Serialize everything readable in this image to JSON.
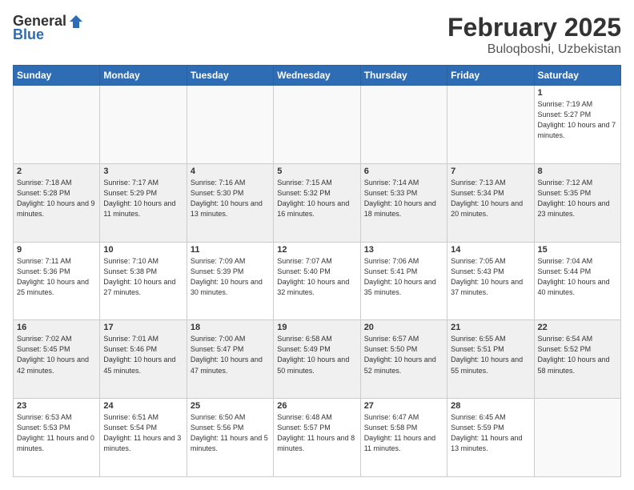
{
  "header": {
    "logo_general": "General",
    "logo_blue": "Blue",
    "title": "February 2025",
    "subtitle": "Buloqboshi, Uzbekistan"
  },
  "days_of_week": [
    "Sunday",
    "Monday",
    "Tuesday",
    "Wednesday",
    "Thursday",
    "Friday",
    "Saturday"
  ],
  "weeks": [
    {
      "shade": false,
      "days": [
        {
          "num": "",
          "info": ""
        },
        {
          "num": "",
          "info": ""
        },
        {
          "num": "",
          "info": ""
        },
        {
          "num": "",
          "info": ""
        },
        {
          "num": "",
          "info": ""
        },
        {
          "num": "",
          "info": ""
        },
        {
          "num": "1",
          "info": "Sunrise: 7:19 AM\nSunset: 5:27 PM\nDaylight: 10 hours and 7 minutes."
        }
      ]
    },
    {
      "shade": true,
      "days": [
        {
          "num": "2",
          "info": "Sunrise: 7:18 AM\nSunset: 5:28 PM\nDaylight: 10 hours and 9 minutes."
        },
        {
          "num": "3",
          "info": "Sunrise: 7:17 AM\nSunset: 5:29 PM\nDaylight: 10 hours and 11 minutes."
        },
        {
          "num": "4",
          "info": "Sunrise: 7:16 AM\nSunset: 5:30 PM\nDaylight: 10 hours and 13 minutes."
        },
        {
          "num": "5",
          "info": "Sunrise: 7:15 AM\nSunset: 5:32 PM\nDaylight: 10 hours and 16 minutes."
        },
        {
          "num": "6",
          "info": "Sunrise: 7:14 AM\nSunset: 5:33 PM\nDaylight: 10 hours and 18 minutes."
        },
        {
          "num": "7",
          "info": "Sunrise: 7:13 AM\nSunset: 5:34 PM\nDaylight: 10 hours and 20 minutes."
        },
        {
          "num": "8",
          "info": "Sunrise: 7:12 AM\nSunset: 5:35 PM\nDaylight: 10 hours and 23 minutes."
        }
      ]
    },
    {
      "shade": false,
      "days": [
        {
          "num": "9",
          "info": "Sunrise: 7:11 AM\nSunset: 5:36 PM\nDaylight: 10 hours and 25 minutes."
        },
        {
          "num": "10",
          "info": "Sunrise: 7:10 AM\nSunset: 5:38 PM\nDaylight: 10 hours and 27 minutes."
        },
        {
          "num": "11",
          "info": "Sunrise: 7:09 AM\nSunset: 5:39 PM\nDaylight: 10 hours and 30 minutes."
        },
        {
          "num": "12",
          "info": "Sunrise: 7:07 AM\nSunset: 5:40 PM\nDaylight: 10 hours and 32 minutes."
        },
        {
          "num": "13",
          "info": "Sunrise: 7:06 AM\nSunset: 5:41 PM\nDaylight: 10 hours and 35 minutes."
        },
        {
          "num": "14",
          "info": "Sunrise: 7:05 AM\nSunset: 5:43 PM\nDaylight: 10 hours and 37 minutes."
        },
        {
          "num": "15",
          "info": "Sunrise: 7:04 AM\nSunset: 5:44 PM\nDaylight: 10 hours and 40 minutes."
        }
      ]
    },
    {
      "shade": true,
      "days": [
        {
          "num": "16",
          "info": "Sunrise: 7:02 AM\nSunset: 5:45 PM\nDaylight: 10 hours and 42 minutes."
        },
        {
          "num": "17",
          "info": "Sunrise: 7:01 AM\nSunset: 5:46 PM\nDaylight: 10 hours and 45 minutes."
        },
        {
          "num": "18",
          "info": "Sunrise: 7:00 AM\nSunset: 5:47 PM\nDaylight: 10 hours and 47 minutes."
        },
        {
          "num": "19",
          "info": "Sunrise: 6:58 AM\nSunset: 5:49 PM\nDaylight: 10 hours and 50 minutes."
        },
        {
          "num": "20",
          "info": "Sunrise: 6:57 AM\nSunset: 5:50 PM\nDaylight: 10 hours and 52 minutes."
        },
        {
          "num": "21",
          "info": "Sunrise: 6:55 AM\nSunset: 5:51 PM\nDaylight: 10 hours and 55 minutes."
        },
        {
          "num": "22",
          "info": "Sunrise: 6:54 AM\nSunset: 5:52 PM\nDaylight: 10 hours and 58 minutes."
        }
      ]
    },
    {
      "shade": false,
      "days": [
        {
          "num": "23",
          "info": "Sunrise: 6:53 AM\nSunset: 5:53 PM\nDaylight: 11 hours and 0 minutes."
        },
        {
          "num": "24",
          "info": "Sunrise: 6:51 AM\nSunset: 5:54 PM\nDaylight: 11 hours and 3 minutes."
        },
        {
          "num": "25",
          "info": "Sunrise: 6:50 AM\nSunset: 5:56 PM\nDaylight: 11 hours and 5 minutes."
        },
        {
          "num": "26",
          "info": "Sunrise: 6:48 AM\nSunset: 5:57 PM\nDaylight: 11 hours and 8 minutes."
        },
        {
          "num": "27",
          "info": "Sunrise: 6:47 AM\nSunset: 5:58 PM\nDaylight: 11 hours and 11 minutes."
        },
        {
          "num": "28",
          "info": "Sunrise: 6:45 AM\nSunset: 5:59 PM\nDaylight: 11 hours and 13 minutes."
        },
        {
          "num": "",
          "info": ""
        }
      ]
    }
  ]
}
